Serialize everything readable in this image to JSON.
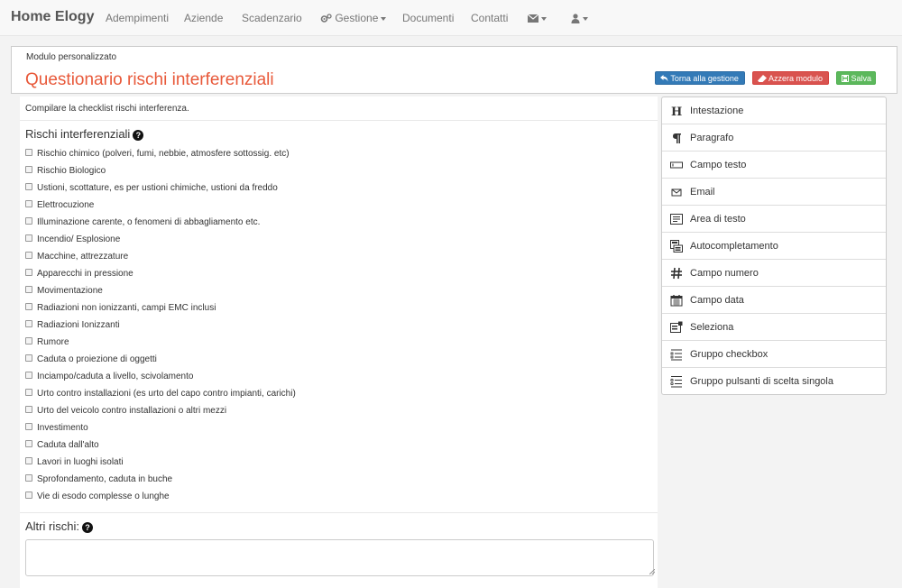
{
  "nav": {
    "brand": "Home Elogy",
    "items": [
      "Adempimenti",
      "Aziende",
      "Scadenzario",
      "Gestione",
      "Documenti",
      "Contatti"
    ],
    "mail_icon": "envelope-icon",
    "user_icon": "user-icon",
    "gestione_icon": "gears-icon"
  },
  "header": {
    "module_label": "Modulo personalizzato",
    "title": "Questionario rischi interferenziali",
    "buttons": {
      "back": "Torna alla gestione",
      "reset": "Azzera modulo",
      "save": "Salva"
    }
  },
  "form": {
    "intro": "Compilare la checklist rischi interferenza.",
    "section1": "Rischi interferenziali",
    "risks": [
      "Rischio chimico (polveri, fumi, nebbie, atmosfere sottossig. etc)",
      "Rischio Biologico",
      "Ustioni, scottature, es per ustioni chimiche, ustioni da freddo",
      "Elettrocuzione",
      "Illuminazione carente, o fenomeni di abbagliamento etc.",
      "Incendio/ Esplosione",
      "Macchine, attrezzature",
      "Apparecchi in pressione",
      "Movimentazione",
      "Radiazioni non ionizzanti, campi EMC inclusi",
      "Radiazioni Ionizzanti",
      "Rumore",
      "Caduta o proiezione di oggetti",
      "Inciampo/caduta a livello, scivolamento",
      "Urto contro installazioni (es urto del capo contro impianti, carichi)",
      "Urto del veicolo contro installazioni o altri mezzi",
      "Investimento",
      "Caduta dall'alto",
      "Lavori in luoghi isolati",
      "Sprofondamento, caduta in buche",
      "Vie di esodo complesse o lunghe"
    ],
    "section2": "Altri rischi:",
    "other_value": ""
  },
  "palette": [
    {
      "label": "Intestazione",
      "icon": "heading-icon"
    },
    {
      "label": "Paragrafo",
      "icon": "paragraph-icon"
    },
    {
      "label": "Campo testo",
      "icon": "text-field-icon"
    },
    {
      "label": "Email",
      "icon": "email-icon"
    },
    {
      "label": "Area di testo",
      "icon": "textarea-icon"
    },
    {
      "label": "Autocompletamento",
      "icon": "autocomplete-icon"
    },
    {
      "label": "Campo numero",
      "icon": "hash-icon"
    },
    {
      "label": "Campo data",
      "icon": "calendar-icon"
    },
    {
      "label": "Seleziona",
      "icon": "select-icon"
    },
    {
      "label": "Gruppo checkbox",
      "icon": "checkbox-group-icon"
    },
    {
      "label": "Gruppo pulsanti di scelta singola",
      "icon": "radio-group-icon"
    }
  ],
  "colors": {
    "title": "#e8593a",
    "primary": "#337ab7",
    "danger": "#d9534f",
    "success": "#5cb85c"
  }
}
